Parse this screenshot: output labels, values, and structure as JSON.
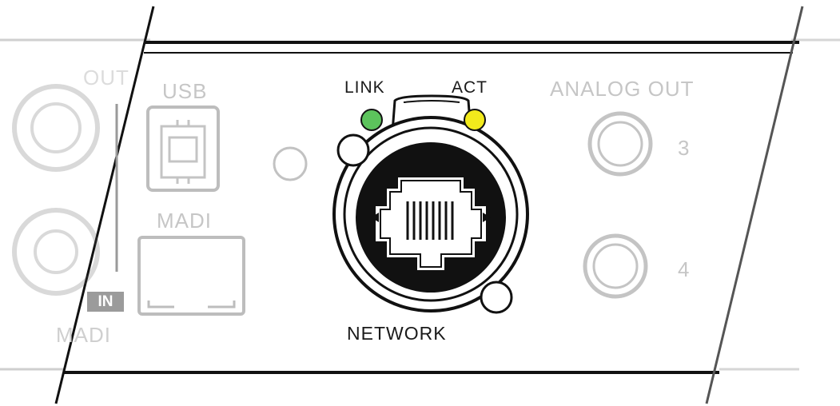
{
  "labels": {
    "out_partial": "OUT",
    "usb": "USB",
    "madi": "MADI",
    "in_badge": "IN",
    "madi_bottom": "MADI",
    "link": "LINK",
    "act": "ACT",
    "network": "NETWORK",
    "analog_out": "ANALOG OUT",
    "ch3": "3",
    "ch4": "4"
  },
  "indicators": {
    "link_color": "#5cc35c",
    "act_color": "#f2ea1c"
  },
  "icons": [
    "usb-b-port-icon",
    "madi-port-icon",
    "ethercon-rj45-icon",
    "jack-socket-icon",
    "bnc-connector-icon",
    "led-icon"
  ]
}
